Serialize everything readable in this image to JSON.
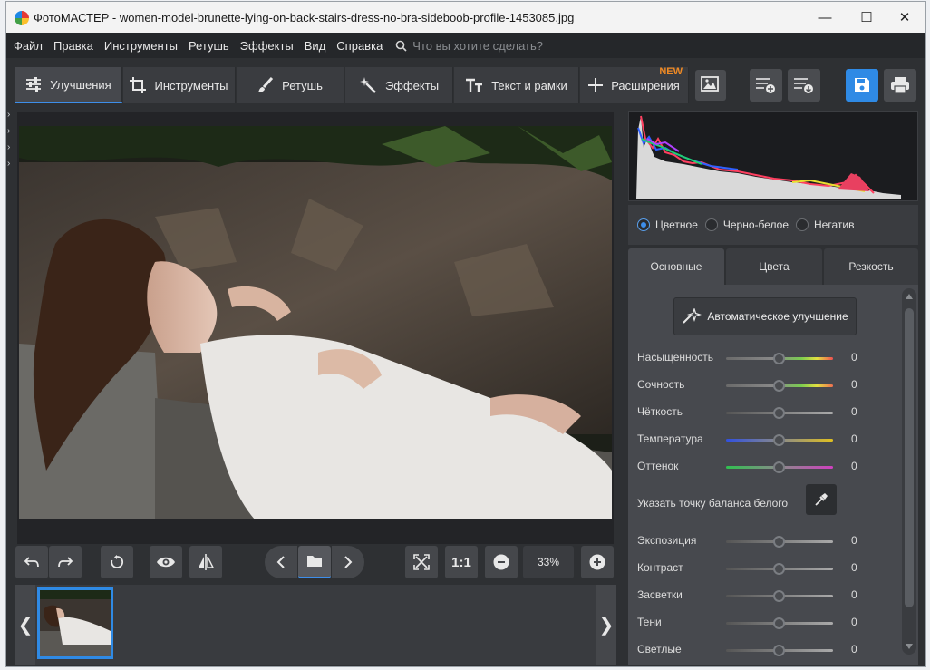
{
  "window": {
    "title": "ФотоМАСТЕР - women-model-brunette-lying-on-back-stairs-dress-no-bra-sideboob-profile-1453085.jpg",
    "minimize": "—",
    "maximize": "☐",
    "close": "✕"
  },
  "menu": {
    "items": [
      "Файл",
      "Правка",
      "Инструменты",
      "Ретушь",
      "Эффекты",
      "Вид",
      "Справка"
    ],
    "search_placeholder": "Что вы хотите сделать?"
  },
  "toolbar": {
    "tabs": [
      "Улучшения",
      "Инструменты",
      "Ретушь",
      "Эффекты",
      "Текст и рамки",
      "Расширения"
    ],
    "active_tab": "Улучшения",
    "new_badge": "NEW"
  },
  "bottombar": {
    "ratio_label": "1:1",
    "zoom": "33%"
  },
  "panel": {
    "modes": [
      "Цветное",
      "Черно-белое",
      "Негатив"
    ],
    "selected_mode": "Цветное",
    "tabs": [
      "Основные",
      "Цвета",
      "Резкость"
    ],
    "active_tab": "Основные",
    "auto_label": "Автоматическое улучшение",
    "white_balance_label": "Указать точку баланса белого",
    "sliders_top": [
      {
        "label": "Насыщенность",
        "value": "0"
      },
      {
        "label": "Сочность",
        "value": "0"
      },
      {
        "label": "Чёткость",
        "value": "0"
      },
      {
        "label": "Температура",
        "value": "0"
      },
      {
        "label": "Оттенок",
        "value": "0"
      }
    ],
    "sliders_bottom": [
      {
        "label": "Экспозиция",
        "value": "0"
      },
      {
        "label": "Контраст",
        "value": "0"
      },
      {
        "label": "Засветки",
        "value": "0"
      },
      {
        "label": "Тени",
        "value": "0"
      },
      {
        "label": "Светлые",
        "value": "0"
      }
    ]
  },
  "colors": {
    "accent": "#2f8ae5",
    "new_badge": "#f08a24"
  }
}
